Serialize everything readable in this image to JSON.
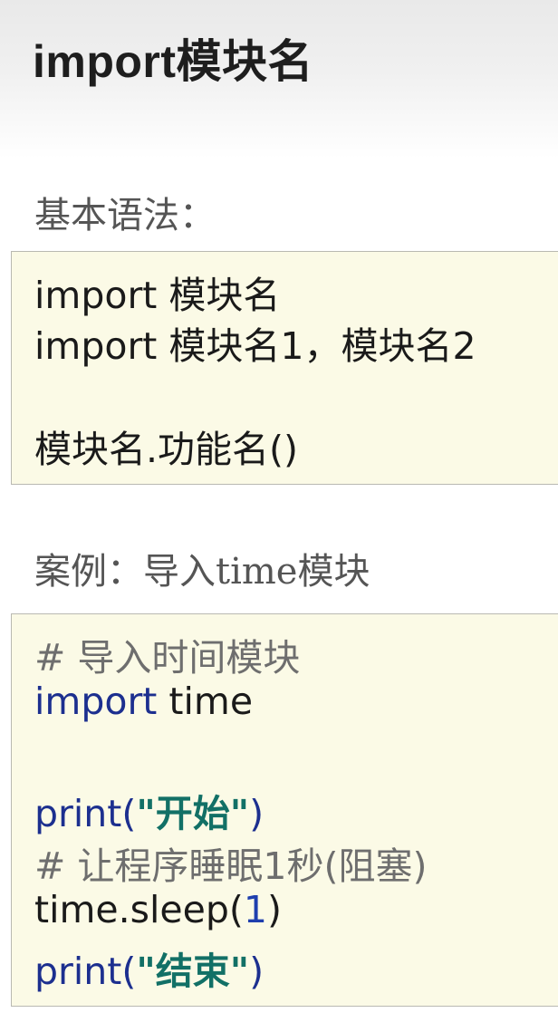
{
  "title": "import模块名",
  "syntax_section": {
    "label": "基本语法：",
    "lines": [
      "import 模块名",
      "import 模块名1，模块名2",
      "模块名.功能名()"
    ]
  },
  "example_section": {
    "label": "案例：导入time模块",
    "code": {
      "comment1": "# 导入时间模块",
      "import_kw": "import",
      "import_mod": " time",
      "print1_fn": "print(",
      "print1_str": "\"开始\"",
      "print1_close": ")",
      "comment2": "# 让程序睡眠1秒(阻塞)",
      "sleep_call": "time.sleep(",
      "sleep_arg": "1",
      "sleep_close": ")",
      "print2_fn": "print(",
      "print2_str": "\"结束\"",
      "print2_close": ")"
    }
  }
}
